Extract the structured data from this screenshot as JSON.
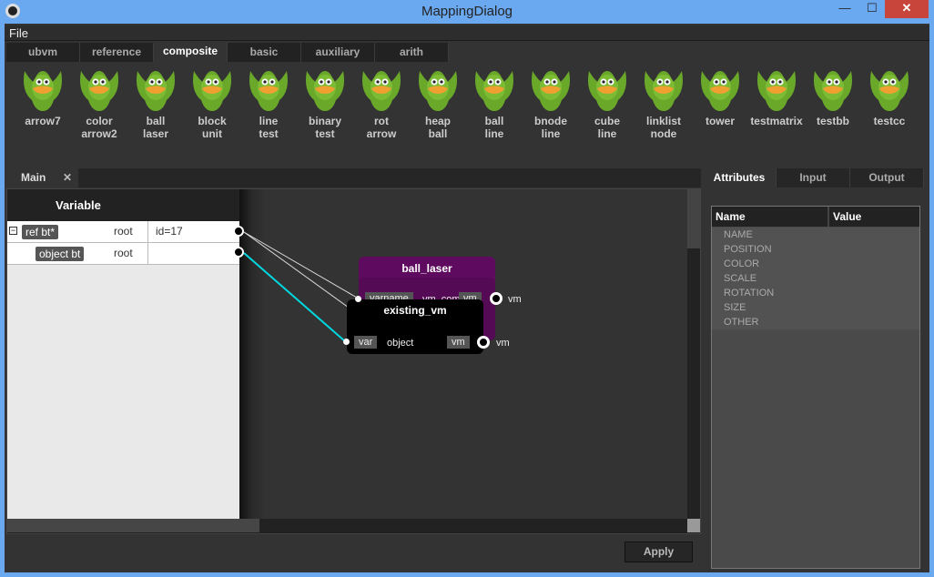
{
  "window": {
    "title": "MappingDialog",
    "minimize": "—",
    "maximize": "☐",
    "close": "✕"
  },
  "menu": {
    "file": "File"
  },
  "palette_tabs": [
    {
      "label": "ubvm"
    },
    {
      "label": "reference"
    },
    {
      "label": "composite",
      "active": true
    },
    {
      "label": "basic"
    },
    {
      "label": "auxiliary"
    },
    {
      "label": "arith"
    }
  ],
  "palette_items": [
    {
      "l1": "arrow7",
      "l2": ""
    },
    {
      "l1": "color",
      "l2": "arrow2"
    },
    {
      "l1": "ball",
      "l2": "laser"
    },
    {
      "l1": "block",
      "l2": "unit"
    },
    {
      "l1": "line",
      "l2": "test"
    },
    {
      "l1": "binary",
      "l2": "test"
    },
    {
      "l1": "rot",
      "l2": "arrow"
    },
    {
      "l1": "heap",
      "l2": "ball"
    },
    {
      "l1": "ball",
      "l2": "line"
    },
    {
      "l1": "bnode",
      "l2": "line"
    },
    {
      "l1": "cube",
      "l2": "line"
    },
    {
      "l1": "linklist",
      "l2": "node"
    },
    {
      "l1": "tower",
      "l2": ""
    },
    {
      "l1": "testmatrix",
      "l2": ""
    },
    {
      "l1": "testbb",
      "l2": ""
    },
    {
      "l1": "testcc",
      "l2": ""
    }
  ],
  "main_tab": {
    "label": "Main",
    "close": "✕"
  },
  "variable_table": {
    "header": "Variable",
    "rows": [
      {
        "expander": "−",
        "name": "ref bt*",
        "scope": "root",
        "value": "id=17"
      },
      {
        "name": "object bt",
        "scope": "root",
        "value": ""
      }
    ]
  },
  "nodes": {
    "ball_laser": {
      "title": "ball_laser",
      "in_pill": "varname",
      "mid_label": "vm_com",
      "out_pill": "vm",
      "out_label": "vm",
      "color": "#5e0a5e"
    },
    "existing_vm": {
      "title": "existing_vm",
      "in_pill": "var",
      "mid_label": "object",
      "out_pill": "vm",
      "out_label": "vm"
    }
  },
  "connection_color": "#00d8e0",
  "apply_label": "Apply",
  "right_tabs": [
    {
      "label": "Attributes",
      "active": true
    },
    {
      "label": "Input"
    },
    {
      "label": "Output"
    }
  ],
  "attributes": {
    "col_name": "Name",
    "col_value": "Value",
    "rows": [
      "NAME",
      "POSITION",
      "COLOR",
      "SCALE",
      "ROTATION",
      "SIZE",
      "OTHER"
    ]
  }
}
